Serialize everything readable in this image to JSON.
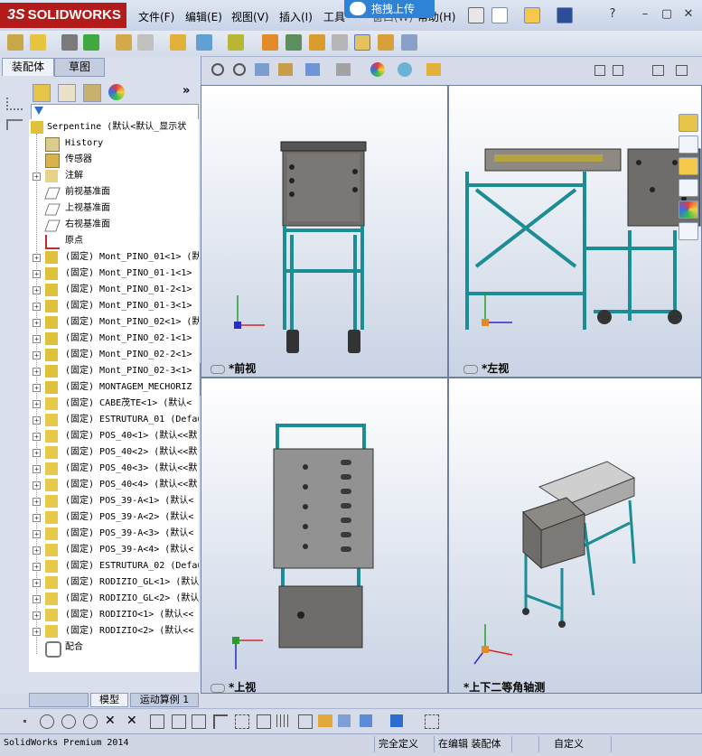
{
  "app": {
    "logo": "SOLIDWORKS",
    "logo_prefix": "3S",
    "menu": [
      "文件(F)",
      "编辑(E)",
      "视图(V)",
      "插入(I)",
      "工具",
      "窗口(W)",
      "帮助(H)"
    ],
    "upload_label": "拖拽上传",
    "window_controls": [
      "?",
      "–",
      "▢",
      "✕"
    ]
  },
  "panel": {
    "tabs": [
      "装配体",
      "草图"
    ],
    "root": "Serpentine  (默认<默认_显示状",
    "tree": [
      {
        "exp": "",
        "icon": "history-icon",
        "label": "History"
      },
      {
        "exp": "",
        "icon": "sensor-icon",
        "label": "传感器"
      },
      {
        "exp": "+",
        "icon": "annotation-icon",
        "label": "注解"
      },
      {
        "exp": "",
        "icon": "plane-icon",
        "label": "前视基准面"
      },
      {
        "exp": "",
        "icon": "plane-icon",
        "label": "上视基准面"
      },
      {
        "exp": "",
        "icon": "plane-icon",
        "label": "右视基准面"
      },
      {
        "exp": "",
        "icon": "origin-icon",
        "label": "原点"
      },
      {
        "exp": "+",
        "icon": "assembly-icon",
        "label": "(固定) Mont_PINO_01<1> (默"
      },
      {
        "exp": "+",
        "icon": "assembly-icon",
        "label": "(固定) Mont_PINO_01-1<1>"
      },
      {
        "exp": "+",
        "icon": "assembly-icon",
        "label": "(固定) Mont_PINO_01-2<1>"
      },
      {
        "exp": "+",
        "icon": "assembly-icon",
        "label": "(固定) Mont_PINO_01-3<1>"
      },
      {
        "exp": "+",
        "icon": "assembly-icon",
        "label": "(固定) Mont_PINO_02<1> (默"
      },
      {
        "exp": "+",
        "icon": "assembly-icon",
        "label": "(固定) Mont_PINO_02-1<1>"
      },
      {
        "exp": "+",
        "icon": "assembly-icon",
        "label": "(固定) Mont_PINO_02-2<1>"
      },
      {
        "exp": "+",
        "icon": "assembly-icon",
        "label": "(固定) Mont_PINO_02-3<1>"
      },
      {
        "exp": "+",
        "icon": "assembly-icon",
        "label": "(固定) MONTAGEM_MECHORIZ"
      },
      {
        "exp": "+",
        "icon": "part-icon",
        "label": "(固定) CABE茂TE<1> (默认<"
      },
      {
        "exp": "+",
        "icon": "part-icon",
        "label": "(固定) ESTRUTURA_01 (Defau"
      },
      {
        "exp": "+",
        "icon": "part-icon",
        "label": "(固定) POS_40<1> (默认<<默"
      },
      {
        "exp": "+",
        "icon": "part-icon",
        "label": "(固定) POS_40<2> (默认<<默"
      },
      {
        "exp": "+",
        "icon": "part-icon",
        "label": "(固定) POS_40<3> (默认<<默"
      },
      {
        "exp": "+",
        "icon": "part-icon",
        "label": "(固定) POS_40<4> (默认<<默"
      },
      {
        "exp": "+",
        "icon": "part-icon",
        "label": "(固定) POS_39-A<1> (默认<"
      },
      {
        "exp": "+",
        "icon": "part-icon",
        "label": "(固定) POS_39-A<2> (默认<"
      },
      {
        "exp": "+",
        "icon": "part-icon",
        "label": "(固定) POS_39-A<3> (默认<"
      },
      {
        "exp": "+",
        "icon": "part-icon",
        "label": "(固定) POS_39-A<4> (默认<"
      },
      {
        "exp": "+",
        "icon": "part-icon",
        "label": "(固定) ESTRUTURA_02 (Defau"
      },
      {
        "exp": "+",
        "icon": "part-icon",
        "label": "(固定) RODIZIO_GL<1> (默认"
      },
      {
        "exp": "+",
        "icon": "part-icon",
        "label": "(固定) RODIZIO_GL<2> (默认"
      },
      {
        "exp": "+",
        "icon": "part-icon",
        "label": "(固定) RODIZIO<1> (默认<<"
      },
      {
        "exp": "+",
        "icon": "part-icon",
        "label": "(固定) RODIZIO<2> (默认<<"
      },
      {
        "exp": "",
        "icon": "mates-icon",
        "label": "配合"
      }
    ],
    "bottom_tabs": [
      "模型",
      "运动算例 1"
    ]
  },
  "viewports": {
    "front": "*前视",
    "left": "*左视",
    "top": "*上视",
    "iso": "*上下二等角轴测"
  },
  "status": {
    "product": "SolidWorks Premium 2014",
    "defined": "完全定义",
    "editing": "在编辑 装配体",
    "custom": "自定义"
  },
  "colors": {
    "frame": "#1c8c95",
    "box": "#6f6d6a",
    "logo": "#b31b1b"
  }
}
